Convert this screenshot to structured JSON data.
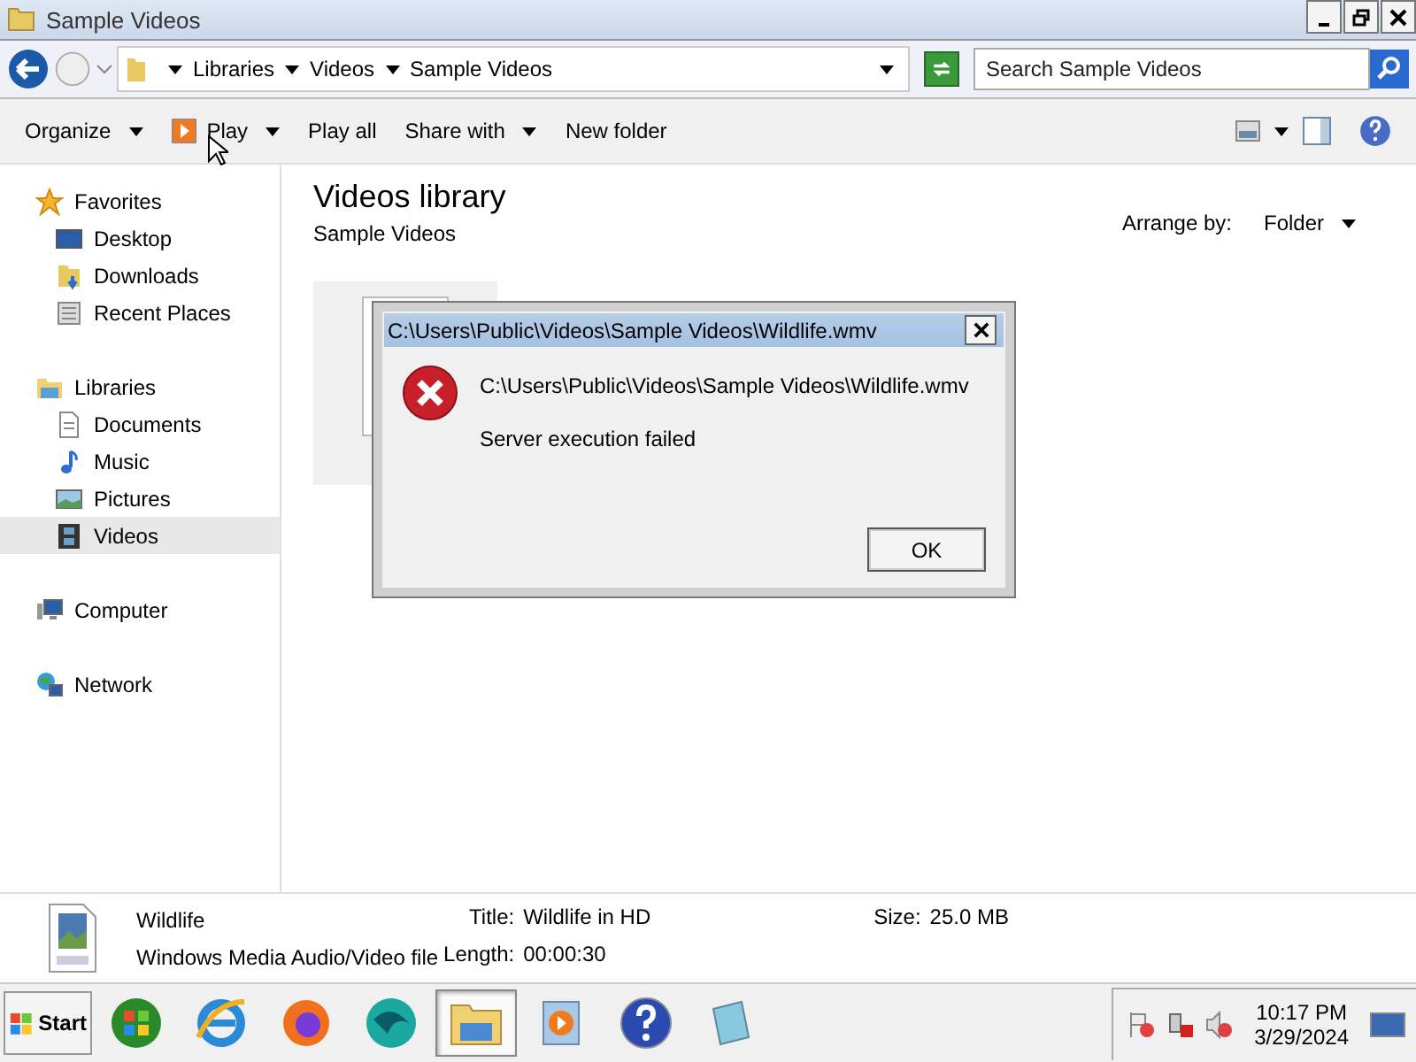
{
  "window": {
    "title": "Sample Videos"
  },
  "address": {
    "crumbs": [
      "Libraries",
      "Videos",
      "Sample Videos"
    ]
  },
  "search": {
    "placeholder": "Search Sample Videos"
  },
  "toolbar": [
    {
      "label": "Organize",
      "dropdown": true
    },
    {
      "label": "Play",
      "dropdown": true,
      "kind": "play"
    },
    {
      "label": "Play all",
      "dropdown": false
    },
    {
      "label": "Share with",
      "dropdown": true
    },
    {
      "label": "New folder",
      "dropdown": false
    }
  ],
  "sidebar": [
    {
      "label": "Favorites",
      "selected": false,
      "children": [
        {
          "label": "Desktop",
          "selected": false
        },
        {
          "label": "Downloads",
          "selected": false
        },
        {
          "label": "Recent Places",
          "selected": false
        }
      ]
    },
    {
      "label": "Libraries",
      "selected": false,
      "children": [
        {
          "label": "Documents",
          "selected": false
        },
        {
          "label": "Music",
          "selected": false
        },
        {
          "label": "Pictures",
          "selected": false
        },
        {
          "label": "Videos",
          "selected": true
        }
      ]
    },
    {
      "label": "Computer",
      "selected": false
    },
    {
      "label": "Network",
      "selected": false
    }
  ],
  "content": {
    "title": "Videos library",
    "subtitle": "Sample Videos",
    "arrange_label": "Arrange by:",
    "arrange_value": "Folder"
  },
  "dialog": {
    "title": "C:\\Users\\Public\\Videos\\Sample Videos\\Wildlife.wmv",
    "path": "C:\\Users\\Public\\Videos\\Sample Videos\\Wildlife.wmv",
    "message": "Server execution failed",
    "button": "OK"
  },
  "details": {
    "name": "Wildlife",
    "type": "Windows Media Audio/Video file",
    "fields": [
      {
        "label": "Title:",
        "value": "Wildlife in HD"
      },
      {
        "label": "Length:",
        "value": "00:00:30"
      },
      {
        "label": "Size:",
        "value": "25.0 MB"
      }
    ]
  },
  "taskbar": {
    "start": "Start",
    "apps": [
      {
        "selected": false
      },
      {
        "selected": false
      },
      {
        "selected": false
      },
      {
        "selected": false
      },
      {
        "selected": true
      },
      {
        "selected": false
      },
      {
        "selected": false
      },
      {
        "selected": false
      }
    ],
    "time": "10:17 PM",
    "date": "3/29/2024"
  }
}
